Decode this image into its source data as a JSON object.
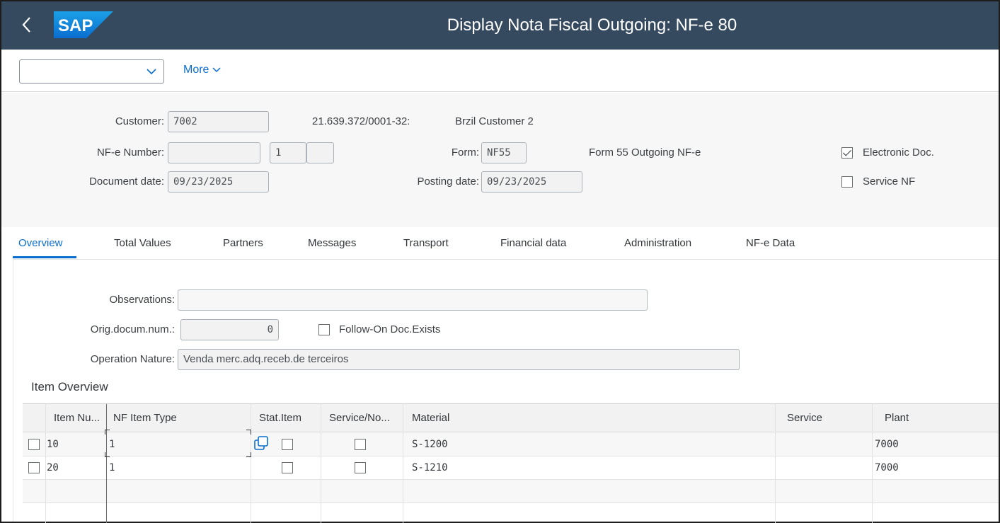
{
  "shell": {
    "title": "Display Nota Fiscal Outgoing: NF-e 80",
    "logo_text": "SAP"
  },
  "toolbar": {
    "select_value": "",
    "more_label": "More"
  },
  "header": {
    "customer_label": "Customer:",
    "customer_value": "7002",
    "customer_tax_id": "21.639.372/0001-32:",
    "customer_name": "Brzil Customer 2",
    "nfe_number_label": "NF-e Number:",
    "nfe_number_value": "",
    "nfe_series_value": "1",
    "nfe_subseries_value": "",
    "form_label": "Form:",
    "form_value": "NF55",
    "form_description": "Form 55 Outgoing NF-e",
    "electronic_doc_label": "Electronic Doc.",
    "electronic_doc_checked": true,
    "service_nf_label": "Service NF",
    "service_nf_checked": false,
    "document_date_label": "Document date:",
    "document_date_value": "09/23/2025",
    "posting_date_label": "Posting date:",
    "posting_date_value": "09/23/2025"
  },
  "tabs": [
    {
      "label": "Overview",
      "active": true
    },
    {
      "label": "Total Values"
    },
    {
      "label": "Partners"
    },
    {
      "label": "Messages"
    },
    {
      "label": "Transport"
    },
    {
      "label": "Financial data"
    },
    {
      "label": "Administration"
    },
    {
      "label": "NF-e Data"
    }
  ],
  "overview": {
    "observations_label": "Observations:",
    "observations_value": "",
    "orig_doc_label": "Orig.docum.num.:",
    "orig_doc_value": "0",
    "follow_on_label": "Follow-On Doc.Exists",
    "follow_on_checked": false,
    "operation_nature_label": "Operation Nature:",
    "operation_nature_value": "Venda merc.adq.receb.de terceiros"
  },
  "item_overview": {
    "title": "Item Overview",
    "columns": [
      "Item Nu...",
      "NF Item Type",
      "Stat.Item",
      "Service/No...",
      "Material",
      "Service",
      "Plant"
    ],
    "rows": [
      {
        "item": "10",
        "type": "1",
        "material": "S-1200",
        "service": "",
        "plant": "7000"
      },
      {
        "item": "20",
        "type": "1",
        "material": "S-1210",
        "service": "",
        "plant": "7000"
      }
    ]
  },
  "colors": {
    "shell_bg": "#354a5f",
    "accent": "#0a6ed1"
  }
}
